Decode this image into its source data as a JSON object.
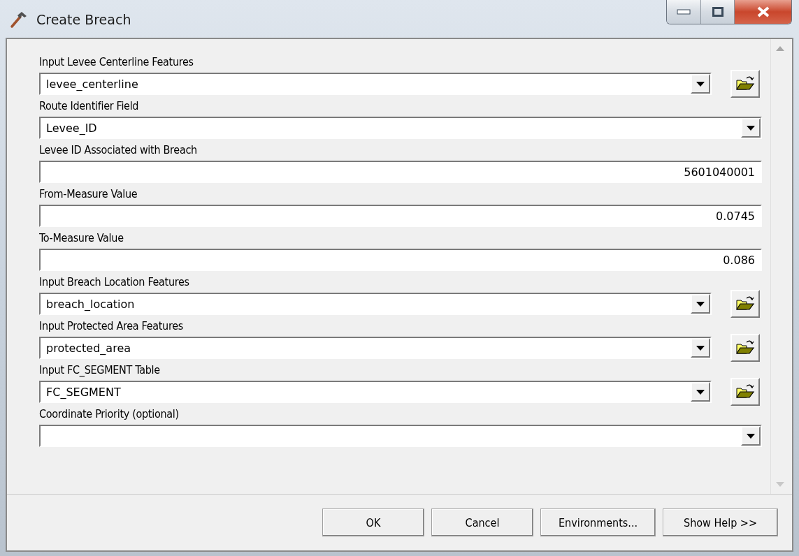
{
  "window": {
    "title": "Create Breach"
  },
  "parameters": [
    {
      "label": "Input Levee Centerline Features",
      "kind": "combo",
      "value": "levee_centerline",
      "browse": true
    },
    {
      "label": "Route Identifier Field",
      "kind": "combo",
      "value": "Levee_ID",
      "browse": false
    },
    {
      "label": "Levee ID Associated with Breach",
      "kind": "number",
      "value": "5601040001",
      "browse": false
    },
    {
      "label": "From-Measure Value",
      "kind": "number",
      "value": "0.0745",
      "browse": false
    },
    {
      "label": "To-Measure Value",
      "kind": "number",
      "value": "0.086",
      "browse": false
    },
    {
      "label": "Input Breach Location Features",
      "kind": "combo",
      "value": "breach_location",
      "browse": true
    },
    {
      "label": "Input Protected Area Features",
      "kind": "combo",
      "value": "protected_area",
      "browse": true
    },
    {
      "label": "Input FC_SEGMENT Table",
      "kind": "combo",
      "value": "FC_SEGMENT",
      "browse": true
    },
    {
      "label": "Coordinate Priority (optional)",
      "kind": "combo",
      "browse": false
    }
  ],
  "buttons": [
    "OK",
    "Cancel",
    "Environments...",
    "Show Help >>"
  ]
}
